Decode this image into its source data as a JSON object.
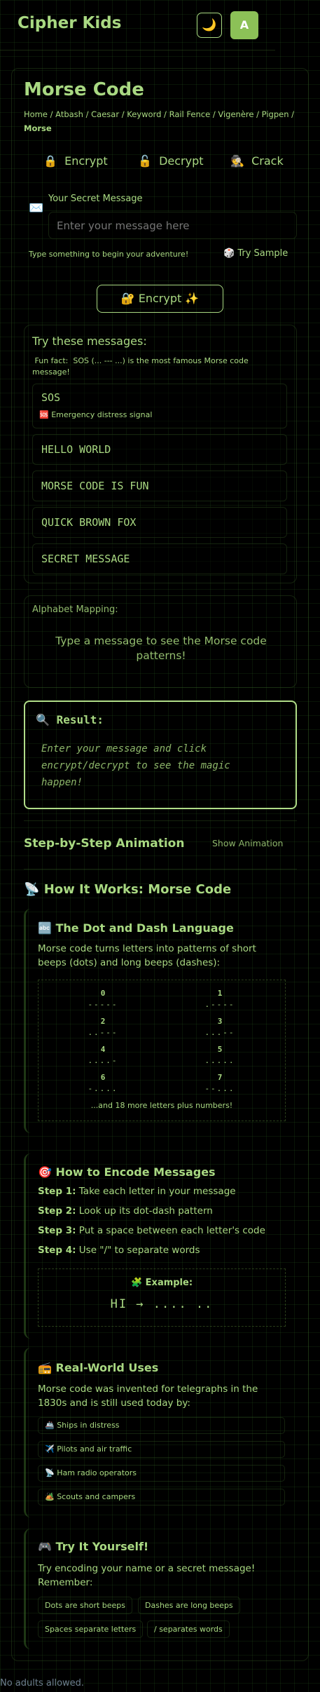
{
  "header": {
    "title": "Cipher Kids",
    "theme_icon": "🌙",
    "avatar_letter": "A"
  },
  "page": {
    "title": "Morse Code",
    "breadcrumb": [
      "Home",
      "Atbash",
      "Caesar",
      "Keyword",
      "Rail Fence",
      "Vigenère",
      "Pigpen"
    ],
    "breadcrumb_current": "Morse",
    "separator": "/"
  },
  "modes": [
    {
      "icon": "🔒",
      "label": "Encrypt"
    },
    {
      "icon": "🔓",
      "label": "Decrypt"
    },
    {
      "icon": "🕵️",
      "label": "Crack"
    }
  ],
  "input": {
    "icon": "✉️",
    "label": "Your Secret Message",
    "placeholder": "Enter your message here",
    "value": "",
    "helper": "Type something to begin your adventure!",
    "sample_icon": "🎲",
    "sample_label": "Try Sample"
  },
  "action": {
    "icon": "🔐",
    "label": "Encrypt",
    "sparkle": "✨"
  },
  "samples": {
    "heading": "Try these messages:",
    "fun_fact": " Fun fact:  SOS (... --- ...) is the most famous Morse code message!",
    "items": [
      {
        "text": "SOS",
        "icon": "🆘",
        "note": "Emergency distress signal"
      },
      {
        "text": "HELLO WORLD"
      },
      {
        "text": "MORSE CODE IS FUN"
      },
      {
        "text": "QUICK BROWN FOX"
      },
      {
        "text": "SECRET MESSAGE"
      }
    ]
  },
  "mapping": {
    "label": "Alphabet Mapping:",
    "empty": "Type a message to see the Morse code patterns!"
  },
  "result": {
    "icon": "🔍",
    "heading": "Result:",
    "placeholder": "Enter your message and click encrypt/decrypt to see the magic happen!"
  },
  "animation": {
    "heading": "Step-by-Step Animation",
    "toggle": "Show Animation"
  },
  "how": {
    "icon": "📡",
    "heading": "How It Works: Morse Code",
    "dot_dash": {
      "icon": "🔤",
      "heading": "The Dot and Dash Language",
      "text": "Morse code turns letters into patterns of short beeps (dots) and long beeps (dashes):",
      "table": [
        {
          "char": "0",
          "code": "-----"
        },
        {
          "char": "1",
          "code": ".----"
        },
        {
          "char": "2",
          "code": "..---"
        },
        {
          "char": "3",
          "code": "...--"
        },
        {
          "char": "4",
          "code": "....-"
        },
        {
          "char": "5",
          "code": "....."
        },
        {
          "char": "6",
          "code": "-...."
        },
        {
          "char": "7",
          "code": "--..."
        }
      ],
      "more": "...and 18 more letters plus numbers!"
    },
    "encode": {
      "icon": "🎯",
      "heading": "How to Encode Messages",
      "steps": [
        {
          "label": "Step 1:",
          "text": "Take each letter in your message"
        },
        {
          "label": "Step 2:",
          "text": "Look up its dot-dash pattern"
        },
        {
          "label": "Step 3:",
          "text": "Put a space between each letter's code"
        },
        {
          "label": "Step 4:",
          "text": "Use \"/\" to separate words"
        }
      ],
      "example_icon": "🧩",
      "example_label": "Example:",
      "example": "HI → .... .."
    },
    "uses": {
      "icon": "📻",
      "heading": "Real-World Uses",
      "text": "Morse code was invented for telegraphs in the 1830s and is still used today by:",
      "items": [
        {
          "icon": "🚢",
          "text": "Ships in distress"
        },
        {
          "icon": "✈️",
          "text": "Pilots and air traffic"
        },
        {
          "icon": "📡",
          "text": "Ham radio operators"
        },
        {
          "icon": "🏕️",
          "text": "Scouts and campers"
        }
      ]
    },
    "try": {
      "icon": "🎮",
      "heading": "Try It Yourself!",
      "text": "Try encoding your name or a secret message! Remember:",
      "chips": [
        "Dots are short beeps",
        "Dashes are long beeps",
        "Spaces separate letters",
        "/ separates words"
      ]
    }
  },
  "footer": {
    "text": "No adults allowed."
  }
}
